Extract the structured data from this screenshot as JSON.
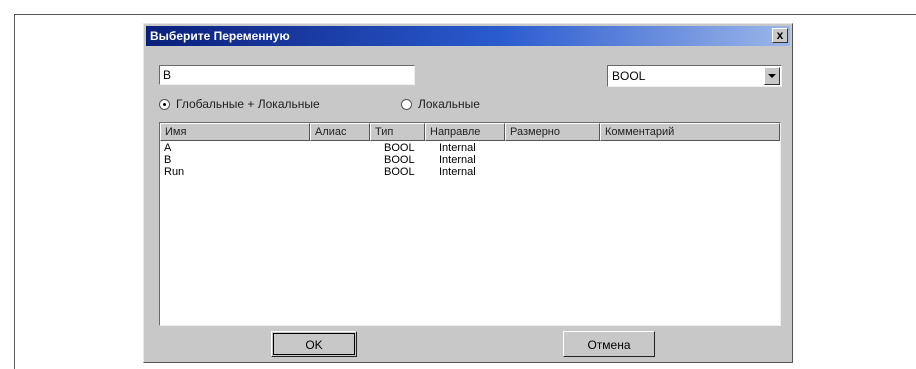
{
  "dialog": {
    "title": "Выберите Переменную",
    "close_label": "x"
  },
  "name_input": {
    "value": "B"
  },
  "type_select": {
    "value": "BOOL"
  },
  "scope": {
    "options": [
      {
        "label": "Глобальные + Локальные",
        "checked": true
      },
      {
        "label": "Локальные",
        "checked": false
      }
    ]
  },
  "list": {
    "columns": [
      "Имя",
      "Алиас",
      "Тип",
      "Направле",
      "Размерно",
      "Комментарий"
    ],
    "rows": [
      {
        "name": "A",
        "alias": "",
        "type": "BOOL",
        "direction": "Internal",
        "dimension": "",
        "comment": ""
      },
      {
        "name": "B",
        "alias": "",
        "type": "BOOL",
        "direction": "Internal",
        "dimension": "",
        "comment": ""
      },
      {
        "name": "Run",
        "alias": "",
        "type": "BOOL",
        "direction": "Internal",
        "dimension": "",
        "comment": ""
      }
    ]
  },
  "buttons": {
    "ok": "OK",
    "cancel": "Отмена"
  }
}
